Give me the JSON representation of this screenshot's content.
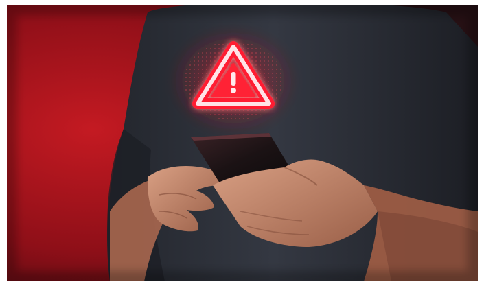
{
  "image": {
    "subject": "person-holding-smartphone",
    "icon": "warning-triangle-icon",
    "colors": {
      "background_red": "#b0141c",
      "background_dark": "#4a0a10",
      "shirt": "#2b2e36",
      "skin": "#c98d70",
      "phone": "#1a1416",
      "glow": "#ff2a3a",
      "icon_white": "#ffe9ec"
    }
  }
}
